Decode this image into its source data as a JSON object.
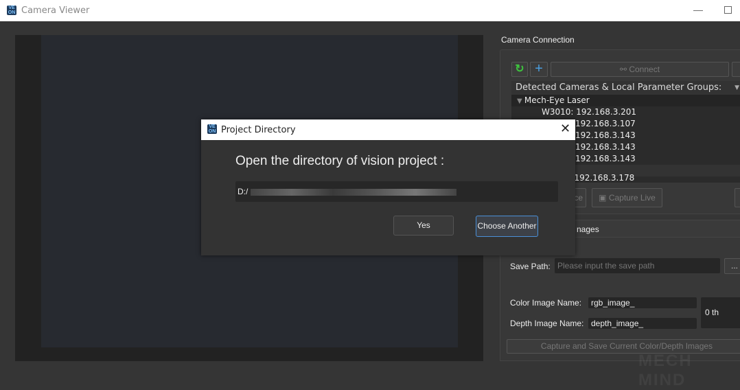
{
  "window": {
    "title": "Camera Viewer"
  },
  "camera_connection": {
    "title": "Camera Connection",
    "connect_label": "Connect",
    "tree_header": "Detected Cameras & Local Parameter Groups:",
    "group": "Mech-Eye Laser",
    "items": [
      "W3010: 192.168.3.201",
      "192.168.3.107",
      "192.168.3.143",
      "192.168.3.143",
      "192.168.3.143",
      "1  192.168.3.178"
    ],
    "capture_once_partial": "ce",
    "capture_live_label": "Capture Live"
  },
  "save_images": {
    "section_partial": "nages",
    "save_path_label": "Save Path:",
    "save_path_placeholder": "Please input the save path",
    "browse_label": "...",
    "color_name_label": "Color Image Name:",
    "color_name_value": "rgb_image_",
    "depth_name_label": "Depth Image Name:",
    "depth_name_value": "depth_image_",
    "index": "0 th",
    "capture_save_label": "Capture and Save Current Color/Depth Images"
  },
  "dialog": {
    "title": "Project Directory",
    "heading": "Open the directory of vision project :",
    "path": "D:/",
    "yes_label": "Yes",
    "choose_label": "Choose Another"
  },
  "watermark": "MECH MIND",
  "colors": {
    "accent": "#4a90d9",
    "refresh": "#3ec43e"
  }
}
